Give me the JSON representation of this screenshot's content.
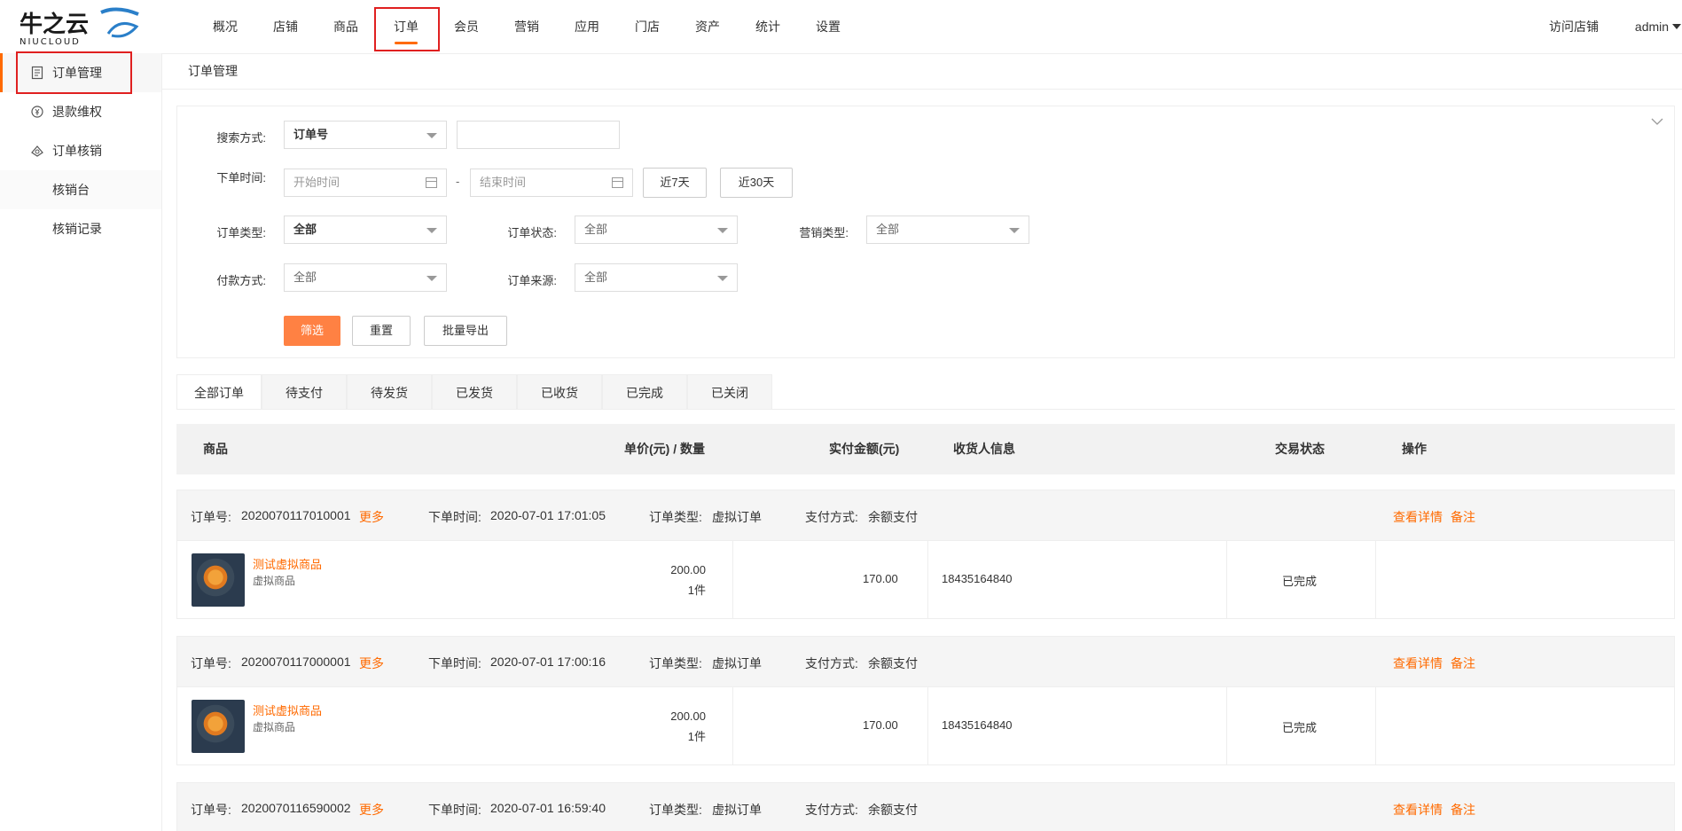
{
  "logo": {
    "main": "牛之云",
    "sub": "NIUCLOUD"
  },
  "topnav": {
    "items": [
      "概况",
      "店铺",
      "商品",
      "订单",
      "会员",
      "营销",
      "应用",
      "门店",
      "资产",
      "统计",
      "设置"
    ],
    "active_index": 3,
    "visit_shop": "访问店铺",
    "user": "admin"
  },
  "sidebar": {
    "items": [
      {
        "label": "订单管理",
        "icon": "order-document-icon",
        "active": true
      },
      {
        "label": "退款维权",
        "icon": "refund-icon",
        "active": false
      },
      {
        "label": "订单核销",
        "icon": "verify-icon",
        "active": false
      },
      {
        "label": "核销台",
        "icon": "",
        "active": false
      },
      {
        "label": "核销记录",
        "icon": "",
        "active": false
      }
    ]
  },
  "breadcrumb": "订单管理",
  "filters": {
    "search_method_label": "搜索方式:",
    "search_method_value": "订单号",
    "search_keyword_value": "",
    "order_time_label": "下单时间:",
    "start_placeholder": "开始时间",
    "dash": "-",
    "end_placeholder": "结束时间",
    "last7": "近7天",
    "last30": "近30天",
    "order_type_label": "订单类型:",
    "order_type_value": "全部",
    "order_status_label": "订单状态:",
    "order_status_value": "全部",
    "marketing_type_label": "营销类型:",
    "marketing_type_value": "全部",
    "pay_method_label": "付款方式:",
    "pay_method_value": "全部",
    "order_source_label": "订单来源:",
    "order_source_value": "全部",
    "filter_btn": "筛选",
    "reset_btn": "重置",
    "export_btn": "批量导出"
  },
  "tabs": [
    "全部订单",
    "待支付",
    "待发货",
    "已发货",
    "已收货",
    "已完成",
    "已关闭"
  ],
  "table_header": {
    "goods": "商品",
    "price_qty": "单价(元) / 数量",
    "paid": "实付金额(元)",
    "receiver": "收货人信息",
    "status": "交易状态",
    "action": "操作"
  },
  "labels": {
    "order_no": "订单号:",
    "more": "更多",
    "order_time": "下单时间:",
    "order_type": "订单类型:",
    "pay_method": "支付方式:",
    "view_detail": "查看详情",
    "remark": "备注"
  },
  "orders": [
    {
      "no": "2020070117010001",
      "time": "2020-07-01 17:01:05",
      "type": "虚拟订单",
      "pay": "余额支付",
      "goods_name": "测试虚拟商品",
      "goods_sub": "虚拟商品",
      "price": "200.00",
      "qty": "1件",
      "paid": "170.00",
      "receiver": "18435164840",
      "status": "已完成"
    },
    {
      "no": "2020070117000001",
      "time": "2020-07-01 17:00:16",
      "type": "虚拟订单",
      "pay": "余额支付",
      "goods_name": "测试虚拟商品",
      "goods_sub": "虚拟商品",
      "price": "200.00",
      "qty": "1件",
      "paid": "170.00",
      "receiver": "18435164840",
      "status": "已完成"
    },
    {
      "no": "2020070116590002",
      "time": "2020-07-01 16:59:40",
      "type": "虚拟订单",
      "pay": "余额支付"
    }
  ],
  "colors": {
    "accent": "#ff6a00",
    "primary_button": "#ff8143",
    "highlight_box": "#e02020"
  }
}
